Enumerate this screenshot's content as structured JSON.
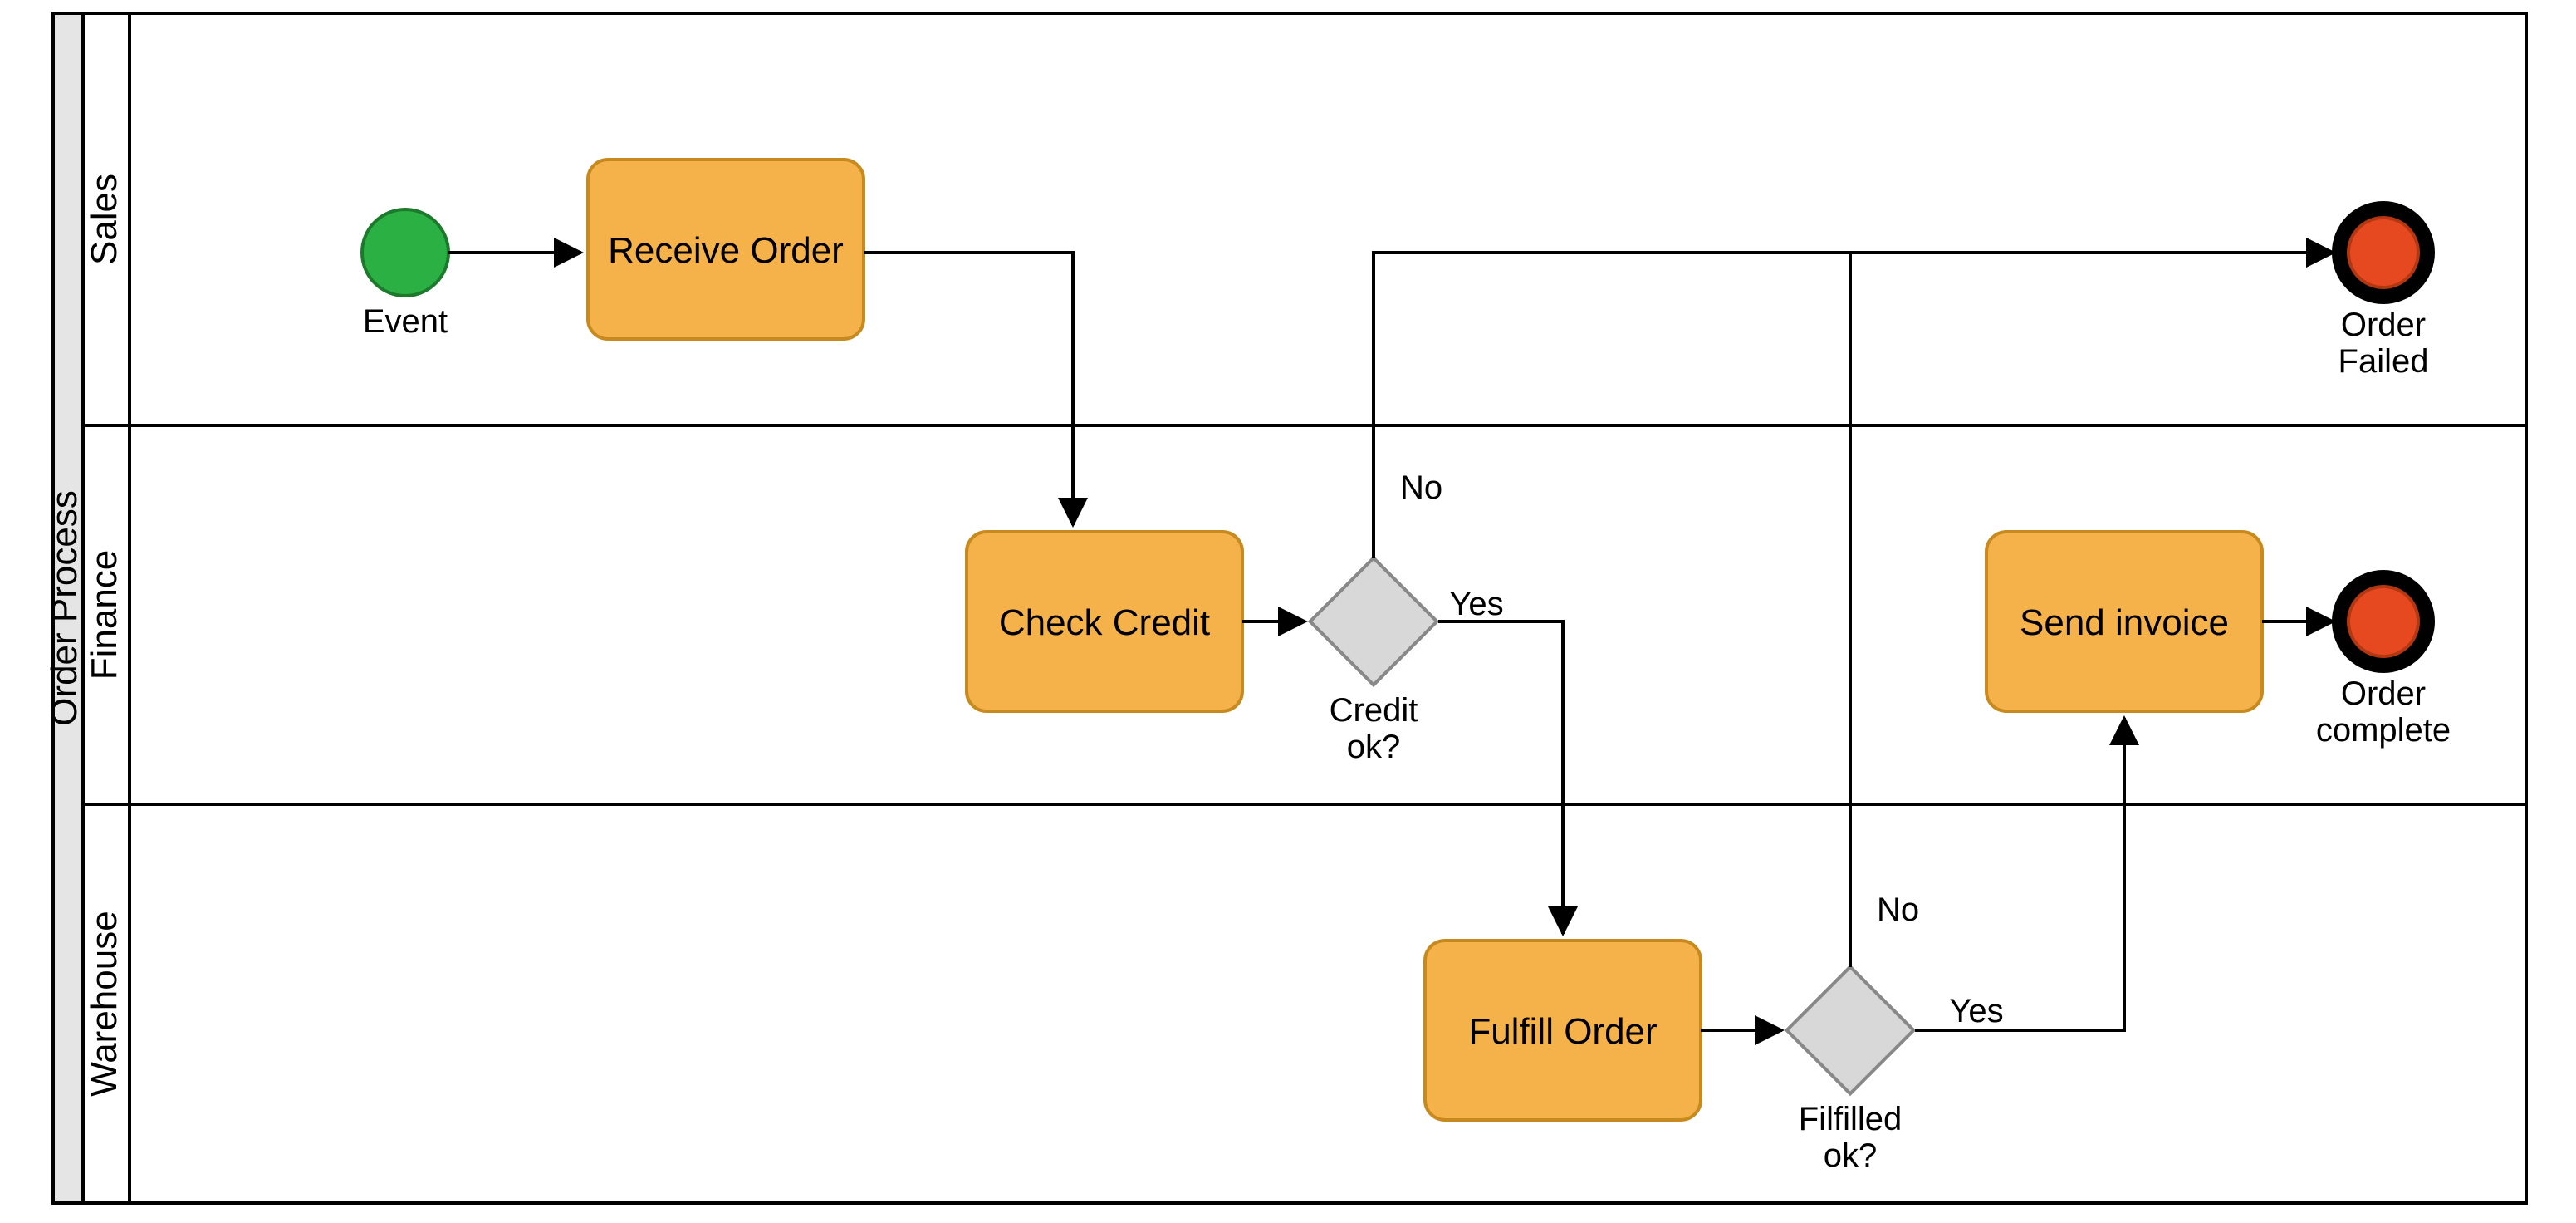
{
  "pool": {
    "title": "Order Process"
  },
  "lanes": {
    "sales": {
      "label": "Sales"
    },
    "finance": {
      "label": "Finance"
    },
    "warehouse": {
      "label": "Warehouse"
    }
  },
  "nodes": {
    "start": {
      "label": "Event"
    },
    "receive_order": {
      "label": "Receive Order"
    },
    "check_credit": {
      "label": "Check Credit"
    },
    "credit_ok": {
      "label1": "Credit",
      "label2": "ok?"
    },
    "fulfill_order": {
      "label": "Fulfill Order"
    },
    "fulfilled_ok": {
      "label1": "Filfilled",
      "label2": "ok?"
    },
    "send_invoice": {
      "label": "Send invoice"
    },
    "order_failed": {
      "label1": "Order",
      "label2": "Failed"
    },
    "order_complete": {
      "label1": "Order",
      "label2": "complete"
    }
  },
  "edges": {
    "credit_no": "No",
    "credit_yes": "Yes",
    "fulfill_no": "No",
    "fulfill_yes": "Yes"
  }
}
